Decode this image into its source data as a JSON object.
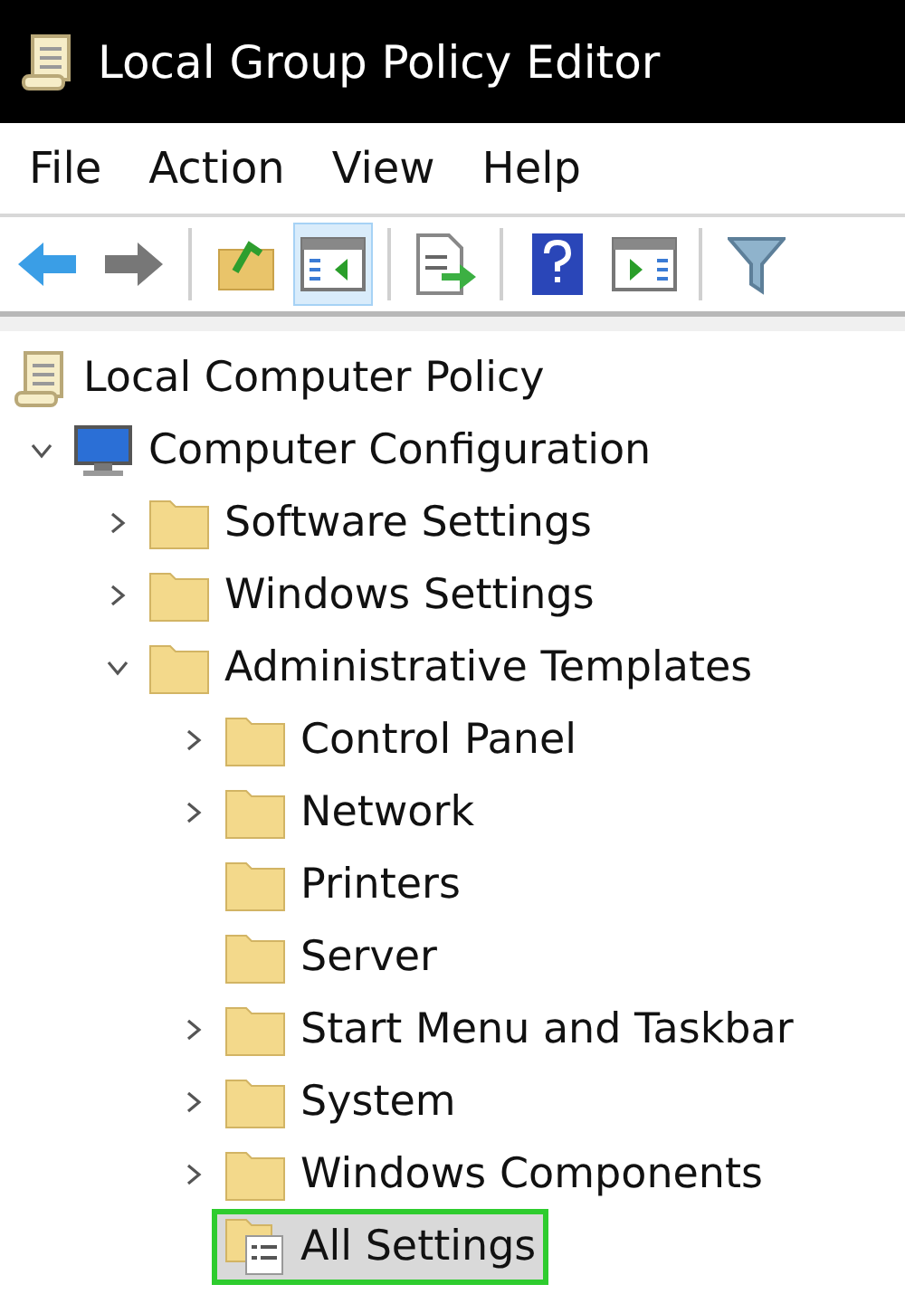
{
  "window": {
    "title": "Local Group Policy Editor"
  },
  "menu": [
    "File",
    "Action",
    "View",
    "Help"
  ],
  "toolbar": [
    {
      "kind": "back",
      "pressed": false
    },
    {
      "kind": "forward",
      "pressed": false
    },
    {
      "kind": "sep"
    },
    {
      "kind": "up",
      "pressed": false
    },
    {
      "kind": "tree",
      "pressed": true
    },
    {
      "kind": "sep"
    },
    {
      "kind": "export",
      "pressed": false
    },
    {
      "kind": "sep"
    },
    {
      "kind": "help",
      "pressed": false
    },
    {
      "kind": "pane",
      "pressed": false
    },
    {
      "kind": "sep"
    },
    {
      "kind": "filter",
      "pressed": false
    }
  ],
  "tree": [
    {
      "label": "Local Computer Policy",
      "kind": "policy",
      "selected": false,
      "children": [
        {
          "label": "Computer Configuration",
          "kind": "computer",
          "expanded": true,
          "selected": false,
          "children": [
            {
              "label": "Software Settings",
              "kind": "folder",
              "expanded": false,
              "selected": false
            },
            {
              "label": "Windows Settings",
              "kind": "folder",
              "expanded": false,
              "selected": false
            },
            {
              "label": "Administrative Templates",
              "kind": "folder",
              "expanded": true,
              "selected": false,
              "children": [
                {
                  "label": "Control Panel",
                  "kind": "folder",
                  "expanded": false,
                  "selected": false
                },
                {
                  "label": "Network",
                  "kind": "folder",
                  "expanded": false,
                  "selected": false
                },
                {
                  "label": "Printers",
                  "kind": "folder",
                  "selected": false
                },
                {
                  "label": "Server",
                  "kind": "folder",
                  "selected": false
                },
                {
                  "label": "Start Menu and Taskbar",
                  "kind": "folder",
                  "expanded": false,
                  "selected": false
                },
                {
                  "label": "System",
                  "kind": "folder",
                  "expanded": false,
                  "selected": false
                },
                {
                  "label": "Windows Components",
                  "kind": "folder",
                  "expanded": false,
                  "selected": false
                },
                {
                  "label": "All Settings",
                  "kind": "settings",
                  "selected": true
                }
              ]
            }
          ]
        }
      ]
    }
  ]
}
